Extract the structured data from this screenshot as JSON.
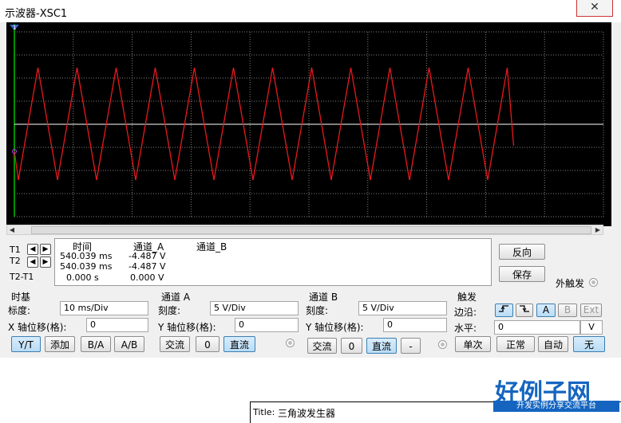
{
  "window": {
    "title": "示波器-XSC1",
    "close_glyph": "✕"
  },
  "screen": {
    "background": "#000000",
    "grid_color": "#808080",
    "trace_a_color": "#e8181c",
    "trace_b_color": "#ffffff",
    "cursor_color": "#00c000",
    "cursor_marker": "1"
  },
  "readout": {
    "t1_label": "T1",
    "t2_label": "T2",
    "diff_label": "T2-T1",
    "headers": {
      "time": "时间",
      "channel_a": "通道_A",
      "channel_b": "通道_B"
    },
    "rows": [
      {
        "time": "540.039 ms",
        "a": "-4.487 V",
        "b": ""
      },
      {
        "time": "540.039 ms",
        "a": "-4.487 V",
        "b": ""
      },
      {
        "time": "0.000 s",
        "a": "0.000 V",
        "b": ""
      }
    ]
  },
  "side_buttons": {
    "reverse": "反向",
    "save": "保存",
    "ext_trigger": "外触发"
  },
  "timebase": {
    "title": "时基",
    "scale_label": "标度:",
    "scale_value": "10 ms/Div",
    "xpos_label": "X 轴位移(格):",
    "xpos_value": "0",
    "buttons": [
      "Y/T",
      "添加",
      "B/A",
      "A/B"
    ]
  },
  "channel_a": {
    "title": "通道 A",
    "scale_label": "刻度:",
    "scale_value": "5  V/Div",
    "ypos_label": "Y 轴位移(格):",
    "ypos_value": "0",
    "buttons": [
      "交流",
      "0",
      "直流"
    ]
  },
  "channel_b": {
    "title": "通道 B",
    "scale_label": "刻度:",
    "scale_value": "5  V/Div",
    "ypos_label": "Y 轴位移(格):",
    "ypos_value": "0",
    "buttons": [
      "交流",
      "0",
      "直流",
      "-"
    ]
  },
  "trigger": {
    "title": "触发",
    "edge_label": "边沿:",
    "edge_buttons": [
      "A",
      "B",
      "Ext"
    ],
    "level_label": "水平:",
    "level_value": "0",
    "level_unit": "V",
    "mode_buttons": [
      "单次",
      "正常",
      "自动",
      "无"
    ]
  },
  "schematic": {
    "title_label": "Title:",
    "title_value": "三角波发生器"
  },
  "watermark": {
    "brand": "好例子网",
    "slogan": "开发实例分享交流平台"
  }
}
